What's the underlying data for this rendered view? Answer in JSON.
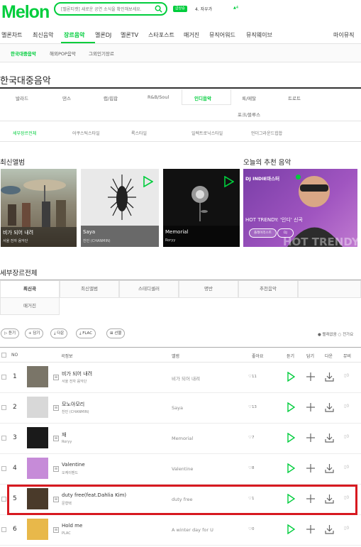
{
  "header": {
    "logo": "Melon",
    "search_placeholder": "[멜론티켓] 새로운 공연 소식을 확인해보세요.",
    "live_badge": "급상승",
    "live_rank": "4. 자우가",
    "live_change": "▲4"
  },
  "nav": [
    "멜론차트",
    "최신음악",
    "장르음악",
    "멜론DJ",
    "멜론TV",
    "스타포스트",
    "매거진",
    "뮤직어워드",
    "뮤직웨이브",
    "마이뮤직"
  ],
  "subnav": [
    "한국대중음악",
    "해외POP음악",
    "그외인기장르"
  ],
  "page_title": "한국대중음악",
  "genres": [
    "발라드",
    "댄스",
    "랩/힙합",
    "R&B/Soul",
    "인디음악",
    "록/메탈",
    "트로트",
    "포크/블루스"
  ],
  "subgenres": [
    "세부장르전체",
    "어쿠스틱스타일",
    "록스타일",
    "일렉트로닉스타일",
    "언더그라운드힙합"
  ],
  "latest_albums": {
    "title": "최신앨범",
    "items": [
      {
        "title": "비가 되어 내려",
        "artist": "서울 전자 음악단"
      },
      {
        "title": "Saya",
        "artist": "찬민 (CHANMIN)"
      },
      {
        "title": "Memorial",
        "artist": "Roryy"
      }
    ]
  },
  "recommend": {
    "title": "오늘의 추천 음악",
    "dj_label": "DJ INDIE마스터",
    "headline": "HOT TRENDY: '인디' 신곡",
    "btn_a": "플레이리스트",
    "btn_b": "DJ",
    "bg_text": "HOT TRENDY"
  },
  "section2_title": "세부장르전체",
  "tabs": [
    "최신곡",
    "최신앨범",
    "스테디셀러",
    "명반",
    "추천음악",
    "매거진"
  ],
  "actions": {
    "play": "듣기",
    "add": "담기",
    "download": "다운",
    "flac": "FLAC",
    "gift": "선물",
    "select_toggle": "● 빨래없음  ○ 전가요"
  },
  "table_headers": [
    "NO",
    "곡정보",
    "앨범",
    "좋아요",
    "듣기",
    "담기",
    "다운",
    "뮤비"
  ],
  "songs": [
    {
      "rank": "1",
      "title": "비가 되어 내려",
      "artist": "서울 전자 음악단",
      "album": "비가 되어 내려",
      "likes": "11",
      "thumb": "#7a7568"
    },
    {
      "rank": "2",
      "title": "모노아모리",
      "artist": "찬민 (CHANMIN)",
      "album": "Saya",
      "likes": "13",
      "thumb": "#d8d8d8"
    },
    {
      "rank": "3",
      "title": "재",
      "artist": "Roryy",
      "album": "Memorial",
      "likes": "7",
      "thumb": "#1a1a1a"
    },
    {
      "rank": "4",
      "title": "Valentine",
      "artist": "오케이밴드",
      "album": "Valentine",
      "likes": "8",
      "thumb": "#c68bd8"
    },
    {
      "rank": "5",
      "title": "duty free(feat.Dahlia Kim)",
      "artist": "문형택",
      "album": "duty free",
      "likes": "1",
      "thumb": "#4a3a2a"
    },
    {
      "rank": "6",
      "title": "Hold me",
      "artist": "PLAC",
      "album": "A winter day for U",
      "likes": "0",
      "thumb": "#e8b84a"
    }
  ],
  "mv_label": "0",
  "colors": {
    "accent": "#00cd3c",
    "highlight": "#d71920"
  }
}
